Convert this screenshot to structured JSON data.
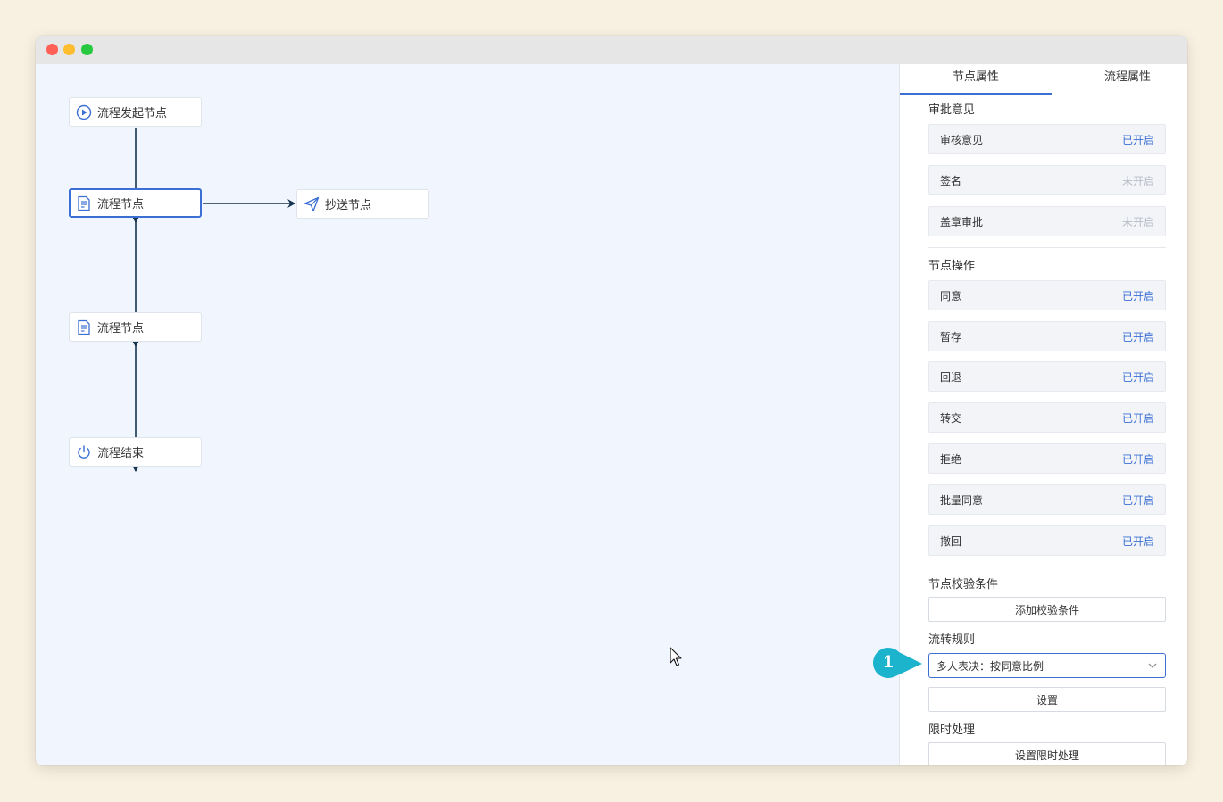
{
  "canvas": {
    "nodes": [
      {
        "id": "start",
        "label": "流程发起节点",
        "icon": "play-circle-icon"
      },
      {
        "id": "node1",
        "label": "流程节点",
        "icon": "form-icon",
        "selected": true
      },
      {
        "id": "cc",
        "label": "抄送节点",
        "icon": "send-icon"
      },
      {
        "id": "node2",
        "label": "流程节点",
        "icon": "form-icon"
      },
      {
        "id": "end",
        "label": "流程结束",
        "icon": "power-icon"
      }
    ]
  },
  "panel": {
    "tabs": [
      {
        "label": "节点属性",
        "active": true
      },
      {
        "label": "流程属性",
        "active": false
      }
    ],
    "approval_opinion": {
      "title": "审批意见",
      "items": [
        {
          "label": "审核意见",
          "status": "已开启",
          "enabled": true
        },
        {
          "label": "签名",
          "status": "未开启",
          "enabled": false
        },
        {
          "label": "盖章审批",
          "status": "未开启",
          "enabled": false
        }
      ]
    },
    "node_operations": {
      "title": "节点操作",
      "items": [
        {
          "label": "同意",
          "status": "已开启"
        },
        {
          "label": "暂存",
          "status": "已开启"
        },
        {
          "label": "回退",
          "status": "已开启"
        },
        {
          "label": "转交",
          "status": "已开启"
        },
        {
          "label": "拒绝",
          "status": "已开启"
        },
        {
          "label": "批量同意",
          "status": "已开启"
        },
        {
          "label": "撤回",
          "status": "已开启"
        }
      ]
    },
    "validation": {
      "title": "节点校验条件",
      "button": "添加校验条件"
    },
    "flow_rule": {
      "title": "流转规则",
      "selected": "多人表决：按同意比例",
      "button": "设置"
    },
    "time_limit": {
      "title": "限时处理",
      "button": "设置限时处理"
    }
  },
  "callout": {
    "number": "1"
  },
  "colors": {
    "accent": "#3b6fd3",
    "edge": "#16344f",
    "callout": "#1cb4cc",
    "canvas_bg": "#f1f5fd"
  }
}
